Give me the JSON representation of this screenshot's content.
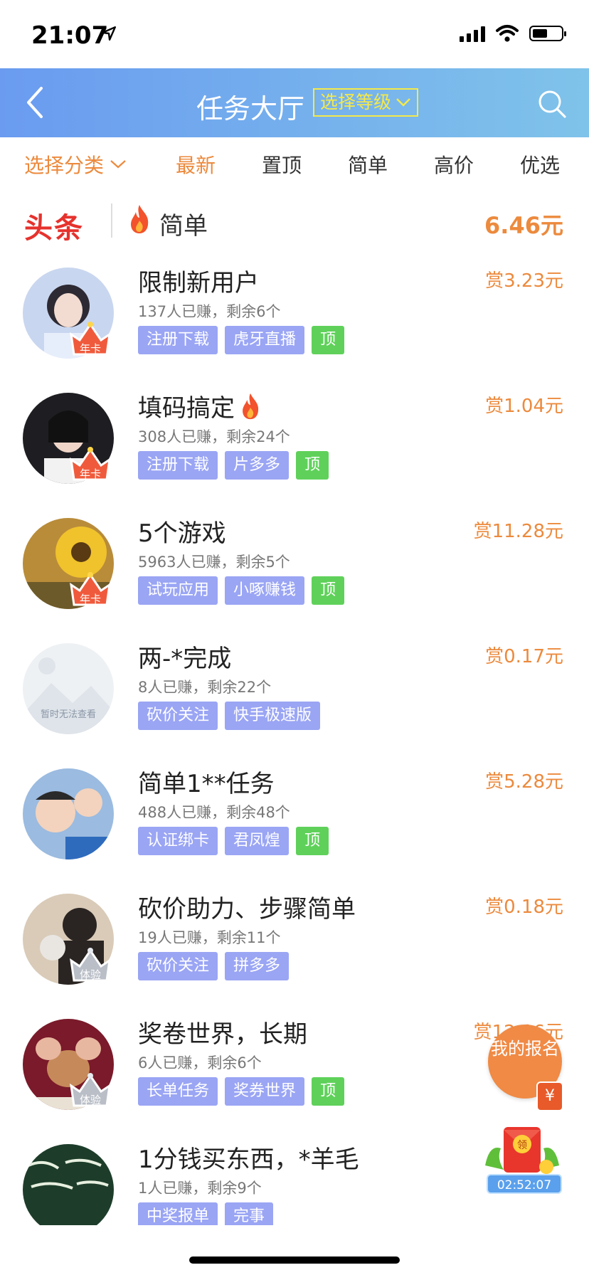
{
  "status": {
    "time": "21:07"
  },
  "nav": {
    "title": "任务大厅",
    "level_btn": "选择等级"
  },
  "filters": {
    "category": "选择分类",
    "tabs": [
      "最新",
      "置顶",
      "简单",
      "高价",
      "优选"
    ]
  },
  "headline": {
    "logo": "头条",
    "text": "简单",
    "amount": "6.46元"
  },
  "tasks": [
    {
      "title": "限制新用户",
      "stats": "137人已赚，剩余6个",
      "reward": "赏3.23元",
      "tags": [
        "注册下载",
        "虎牙直播",
        "顶"
      ],
      "badge": "年卡"
    },
    {
      "title": "填码搞定",
      "stats": "308人已赚，剩余24个",
      "reward": "赏1.04元",
      "tags": [
        "注册下载",
        "片多多",
        "顶"
      ],
      "badge": "年卡"
    },
    {
      "title": "5个游戏",
      "stats": "5963人已赚，剩余5个",
      "reward": "赏11.28元",
      "tags": [
        "试玩应用",
        "小啄赚钱",
        "顶"
      ],
      "badge": "年卡"
    },
    {
      "title": "两-*完成",
      "stats": "8人已赚，剩余22个",
      "reward": "赏0.17元",
      "tags": [
        "砍价关注",
        "快手极速版"
      ],
      "badge": "",
      "avatar_text": "暂时无法查看"
    },
    {
      "title": "简单1**任务",
      "stats": "488人已赚，剩余48个",
      "reward": "赏5.28元",
      "tags": [
        "认证绑卡",
        "君凤煌",
        "顶"
      ],
      "badge": ""
    },
    {
      "title": "砍价助力、步骤简单",
      "stats": "19人已赚，剩余11个",
      "reward": "赏0.18元",
      "tags": [
        "砍价关注",
        "拼多多"
      ],
      "badge": "体验"
    },
    {
      "title": "奖卷世界，长期",
      "stats": "6人已赚，剩余6个",
      "reward": "赏12.06元",
      "tags": [
        "长单任务",
        "奖券世界",
        "顶"
      ],
      "badge": "体验"
    },
    {
      "title": "1分钱买东西，*羊毛",
      "stats": "1人已赚，剩余9个",
      "reward": "",
      "tags": [
        "中奖报单",
        "完事"
      ],
      "badge": ""
    }
  ],
  "floating": {
    "signup": "我的报名",
    "yen": "¥",
    "packet_label": "领",
    "countdown": "02:52:07"
  },
  "colors": {
    "accent": "#ec8a3d",
    "tag": "#9aa5f4",
    "tag_top": "#5fd15a",
    "nav_start": "#6a9bf0",
    "nav_end": "#7fc3ea"
  }
}
